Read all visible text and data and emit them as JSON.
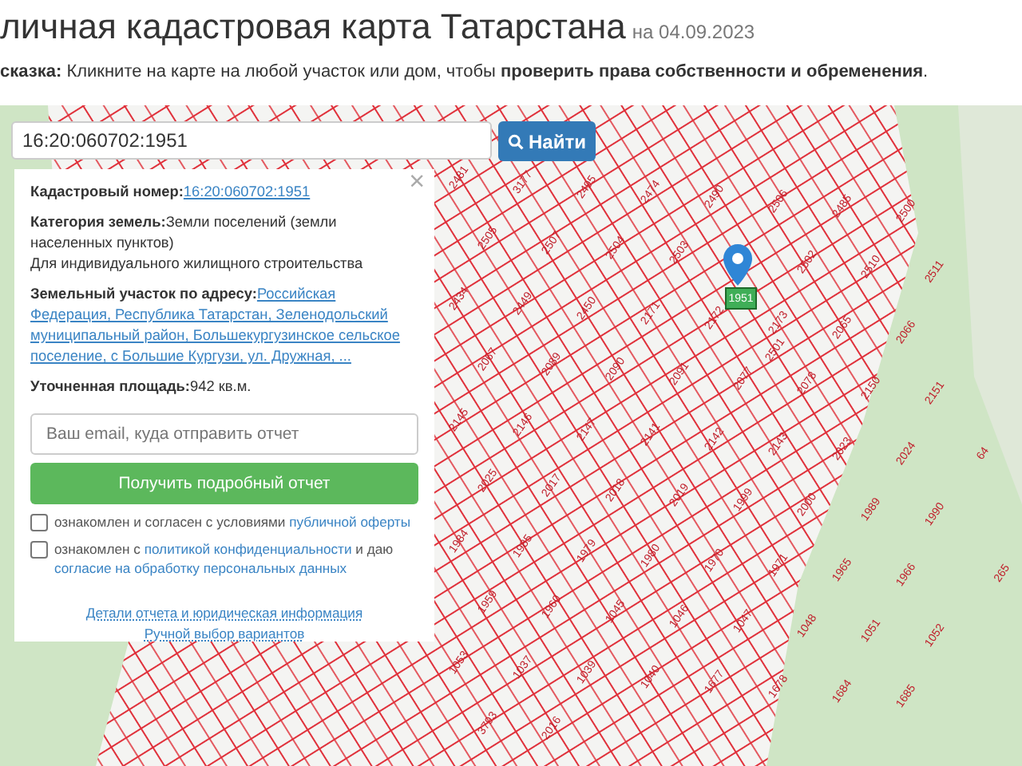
{
  "header": {
    "title": "личная кадастровая карта Татарстана",
    "date": "на 04.09.2023",
    "hint_label": "сказка:",
    "hint_text": "Кликните на карте на любой участок или дом, чтобы ",
    "hint_bold": "проверить права собственности и обременения",
    "hint_end": "."
  },
  "search": {
    "value": "16:20:060702:1951",
    "button": "Найти"
  },
  "panel": {
    "close": "×",
    "fields": [
      {
        "label": "Кадастровый номер:",
        "value": "16:20:060702:1951",
        "kind": "link"
      },
      {
        "label": "Категория земель:",
        "value": "Земли поселений (земли населенных пунктов)",
        "kind": "text"
      },
      {
        "value": "Для индивидуального жилищного строительства",
        "kind": "plain"
      },
      {
        "label": "Земельный участок по адресу:",
        "value": "Российская Федерация, Республика Татарстан, Зеленодольский муниципальный район, Большекургузинское сельское поселение, с Большие Кургузи, ул. Дружная, ...",
        "kind": "link"
      },
      {
        "label": "Уточненная площадь:",
        "value": "942 кв.м.",
        "kind": "text"
      }
    ],
    "email_placeholder": "Ваш email, куда отправить отчет",
    "submit": "Получить подробный отчет",
    "agreements": [
      {
        "checked": false,
        "parts": [
          {
            "kind": "text",
            "text": "ознакомлен и согласен с условиями"
          },
          {
            "kind": "link",
            "text": "публичной оферты"
          }
        ]
      },
      {
        "checked": false,
        "parts": [
          {
            "kind": "text",
            "text": "ознакомлен с"
          },
          {
            "kind": "link",
            "text": "политикой конфиденциальности"
          },
          {
            "kind": "text",
            "text": "и даю"
          },
          {
            "kind": "link",
            "text": "согласие на обработку персональных данных"
          }
        ]
      }
    ],
    "links": [
      "Детали отчета и юридическая информация",
      "Ручной выбор вариантов"
    ]
  },
  "map": {
    "selected_parcel": "1951",
    "parcels": [
      "2481",
      "3177",
      "2495",
      "2474",
      "2490",
      "2506",
      "2485",
      "2500",
      "2505",
      "2507",
      "2504",
      "2503",
      "2501",
      "2502",
      "2510",
      "2511",
      "2434",
      "2449",
      "2450",
      "2171",
      "2172",
      "2173",
      "2065",
      "2066",
      "2067",
      "2089",
      "2090",
      "2091",
      "2077",
      "2078",
      "2150",
      "2151",
      "2145",
      "2146",
      "2147",
      "2141",
      "2142",
      "2143",
      "2023",
      "2024",
      "2025",
      "2017",
      "2018",
      "2019",
      "1999",
      "2000",
      "1989",
      "1990",
      "1984",
      "1985",
      "1979",
      "1980",
      "1970",
      "1971",
      "1965",
      "1966",
      "1959",
      "1960",
      "1045",
      "1046",
      "1047",
      "1048",
      "1051",
      "1052",
      "1053",
      "1037",
      "1039",
      "1040",
      "1677",
      "1678",
      "1684",
      "1685",
      "3793",
      "2016",
      "64",
      "265"
    ]
  }
}
